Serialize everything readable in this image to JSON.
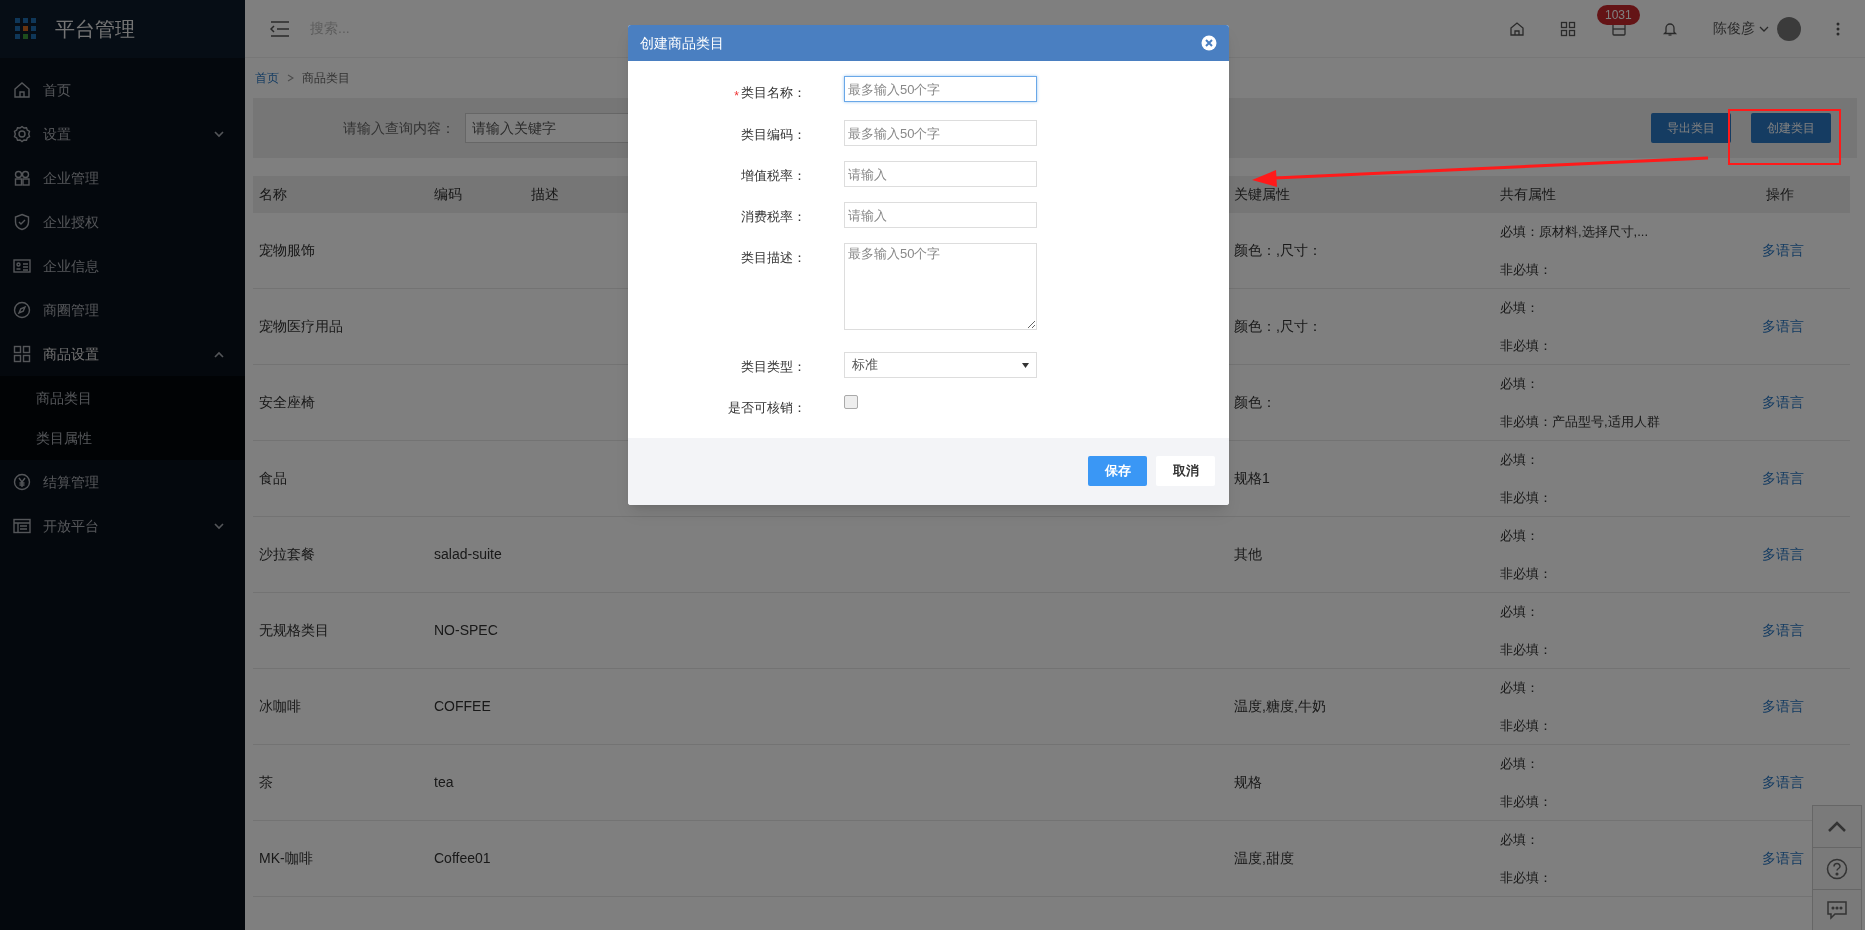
{
  "sidebar": {
    "title": "平台管理",
    "items": [
      {
        "label": "首页",
        "kind": "link"
      },
      {
        "label": "设置",
        "kind": "group",
        "expanded": false
      },
      {
        "label": "企业管理",
        "kind": "link"
      },
      {
        "label": "企业授权",
        "kind": "link"
      },
      {
        "label": "企业信息",
        "kind": "link"
      },
      {
        "label": "商圈管理",
        "kind": "link"
      },
      {
        "label": "商品设置",
        "kind": "group",
        "expanded": true,
        "children": [
          {
            "label": "商品类目"
          },
          {
            "label": "类目属性"
          }
        ]
      },
      {
        "label": "结算管理",
        "kind": "link"
      },
      {
        "label": "开放平台",
        "kind": "group",
        "expanded": false
      }
    ]
  },
  "topbar": {
    "search_placeholder": "搜索...",
    "badge": "1031",
    "user": "陈俊彦"
  },
  "breadcrumb": [
    "首页",
    "商品类目"
  ],
  "filter": {
    "label": "请输入查询内容：",
    "placeholder": "请输入关键字",
    "buttons": [
      "导出类目",
      "创建类目"
    ]
  },
  "table": {
    "columns": [
      "名称",
      "编码",
      "描述",
      "关键属性",
      "共有属性",
      "操作"
    ],
    "rows": [
      {
        "name": "宠物服饰",
        "key_attributes": "颜色：,尺寸：",
        "required": "必填：原材料,选择尺寸,...",
        "optional": "非必填：",
        "action": "多语言"
      },
      {
        "name": "宠物医疗用品",
        "key_attributes": "颜色：,尺寸：",
        "required": "必填：",
        "optional": "非必填：",
        "action": "多语言"
      },
      {
        "name": "安全座椅",
        "key_attributes": "颜色：",
        "required": "必填：",
        "optional": "非必填：产品型号,适用人群",
        "action": "多语言"
      },
      {
        "name": "食品",
        "key_attributes": "规格1",
        "required": "必填：",
        "optional": "非必填：",
        "action": "多语言"
      },
      {
        "name": "沙拉套餐",
        "code": "salad-suite",
        "key_attributes": "其他",
        "required": "必填：",
        "optional": "非必填：",
        "action": "多语言"
      },
      {
        "name": "无规格类目",
        "code": "NO-SPEC",
        "required": "必填：",
        "optional": "非必填：",
        "action": "多语言"
      },
      {
        "name": "冰咖啡",
        "code": "COFFEE",
        "key_attributes": "温度,糖度,牛奶",
        "required": "必填：",
        "optional": "非必填：",
        "action": "多语言"
      },
      {
        "name": "茶",
        "code": "tea",
        "key_attributes": "规格",
        "required": "必填：",
        "optional": "非必填：",
        "action": "多语言"
      },
      {
        "name": "MK-咖啡",
        "code": "Coffee01",
        "key_attributes": "温度,甜度",
        "required": "必填：",
        "optional": "非必填：",
        "action": "多语言"
      }
    ]
  },
  "dialog": {
    "title": "创建商品类目",
    "required_mark": "*",
    "fields": [
      {
        "kind": "input",
        "label": "类目名称：",
        "placeholder": "最多输入50个字",
        "required": true,
        "focused": true
      },
      {
        "kind": "input",
        "label": "类目编码：",
        "placeholder": "最多输入50个字",
        "required": false,
        "focused": false
      },
      {
        "kind": "input",
        "label": "增值税率：",
        "placeholder": "请输入",
        "required": false,
        "focused": false
      },
      {
        "kind": "input",
        "label": "消费税率：",
        "placeholder": "请输入",
        "required": false,
        "focused": false
      },
      {
        "kind": "textarea",
        "label": "类目描述：",
        "placeholder": "最多输入50个字",
        "required": false,
        "focused": false
      },
      {
        "kind": "select",
        "label": "类目类型：",
        "value": "标准",
        "required": false,
        "focused": false
      },
      {
        "kind": "checkbox",
        "label": "是否可核销：",
        "checked": false,
        "required": false,
        "focused": false
      }
    ],
    "buttons": [
      {
        "label": "保存",
        "kind": "primary"
      },
      {
        "label": "取消",
        "kind": "default"
      }
    ]
  }
}
